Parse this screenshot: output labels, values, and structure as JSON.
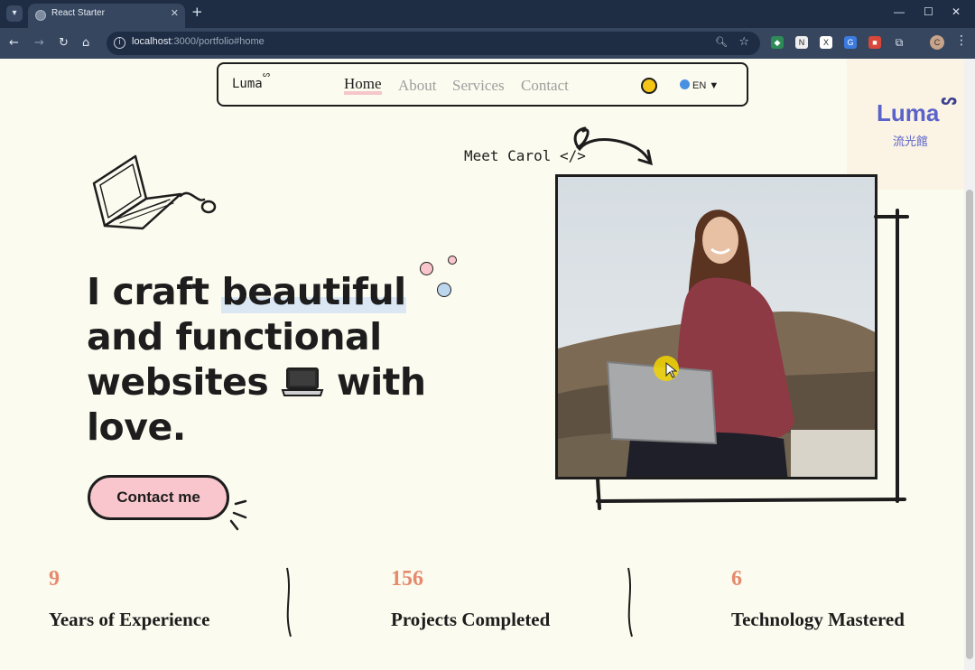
{
  "browser": {
    "tab_title": "React Starter",
    "url_host": "localhost",
    "url_rest": ":3000/portfolio#home",
    "profile_initial": "C"
  },
  "nav": {
    "logo": "Luma",
    "links": [
      "Home",
      "About",
      "Services",
      "Contact"
    ],
    "active": "Home",
    "language": "EN ▼"
  },
  "watermark": {
    "brand": "Luma",
    "subtitle": "流光館"
  },
  "hero": {
    "meet": "Meet Carol </>",
    "line1_pre": "I craft ",
    "line1_hl": "beautiful",
    "line2": "and functional",
    "line3_pre": "websites ",
    "line3_post": " with",
    "line4": "love.",
    "cta": "Contact me"
  },
  "stats": [
    {
      "value": "9",
      "label": "Years of Experience"
    },
    {
      "value": "156",
      "label": "Projects Completed"
    },
    {
      "value": "6",
      "label": "Technology Mastered"
    }
  ],
  "colors": {
    "page_bg": "#fcfbef",
    "accent_pink": "#f8c6cc",
    "stat_number": "#e58a6c",
    "brand_purple": "#5a63c9"
  }
}
